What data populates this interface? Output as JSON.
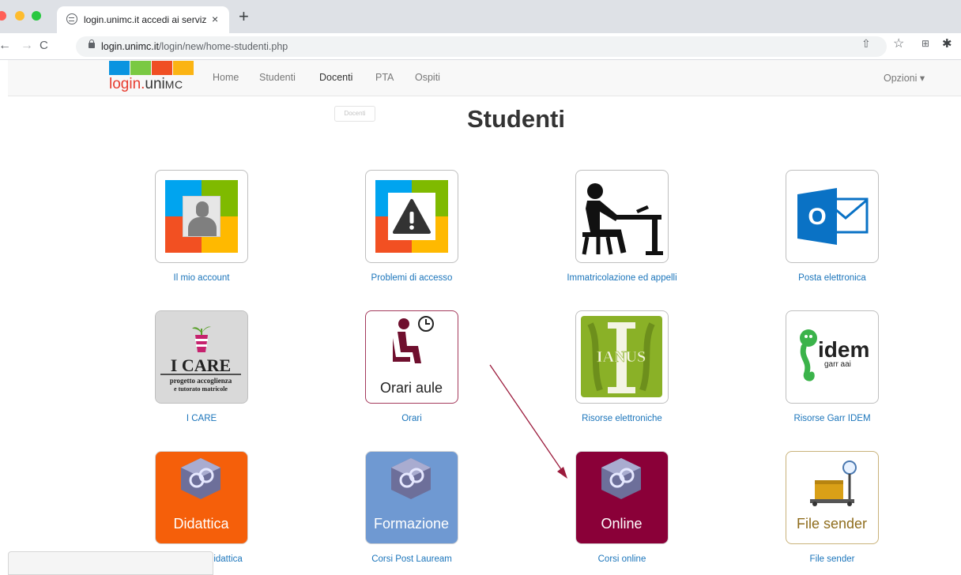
{
  "browser": {
    "tab_title": "login.unimc.it accedi ai servizi",
    "tab_close": "×",
    "new_tab": "+",
    "url_host": "login.unimc.it",
    "url_path": "/login/new/home-studenti.php",
    "nav_back": "←",
    "nav_forward": "→",
    "nav_reload": "C"
  },
  "navbar": {
    "brand_login": "login.",
    "brand_uni": "uni",
    "brand_mc": "MC",
    "links": [
      "Home",
      "Studenti",
      "Docenti",
      "PTA",
      "Ospiti"
    ],
    "active_link": "Docenti",
    "options": "Opzioni ▾"
  },
  "tooltip": "Docenti",
  "page": {
    "title": "Studenti"
  },
  "tiles": [
    {
      "caption": "Il mio account",
      "icon": "account-icon"
    },
    {
      "caption": "Problemi di accesso",
      "icon": "warning-icon"
    },
    {
      "caption": "Immatricolazione ed appelli",
      "icon": "student-desk-icon"
    },
    {
      "caption": "Posta elettronica",
      "icon": "outlook-icon",
      "glyph": "O"
    },
    {
      "caption": "I CARE",
      "icon": "icare-logo",
      "logo_title": "I CARE",
      "logo_sub1": "progetto accoglienza",
      "logo_sub2": "e tutorato matricole"
    },
    {
      "caption": "Orari",
      "icon": "seat-clock-icon",
      "label": "Orari aule"
    },
    {
      "caption": "Risorse elettroniche",
      "icon": "ianus-logo",
      "logo_text": "IANUS"
    },
    {
      "caption": "Risorse Garr IDEM",
      "icon": "idem-logo",
      "logo_main": "idem",
      "logo_sub": "garr aai"
    },
    {
      "caption": "Corsi in teledidattica",
      "icon": "cube-icon",
      "label": "Didattica"
    },
    {
      "caption": "Corsi Post Lauream",
      "icon": "cube-icon",
      "label": "Formazione"
    },
    {
      "caption": "Corsi online",
      "icon": "cube-icon",
      "label": "Online"
    },
    {
      "caption": "File sender",
      "icon": "scale-icon",
      "label": "File sender"
    }
  ],
  "colors": {
    "caption": "#1b75bb",
    "didattica": "#f55f0a",
    "formazione": "#6f99d2",
    "online": "#8a0038",
    "ianus": "#8ab127",
    "annotation_arrow": "#9b1b3c"
  }
}
